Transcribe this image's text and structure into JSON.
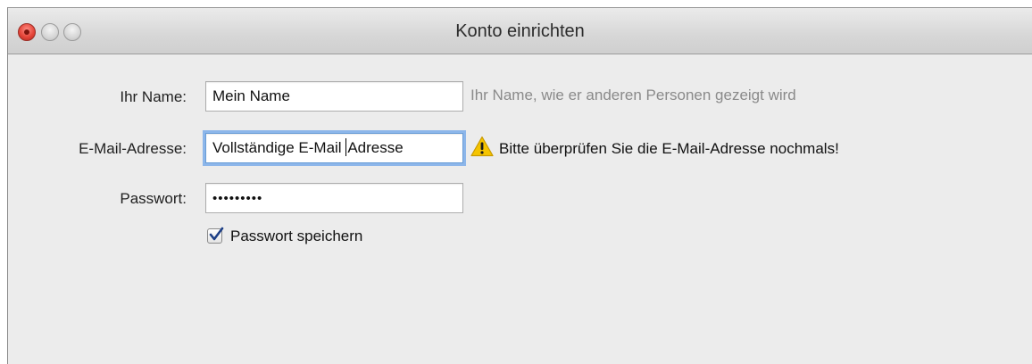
{
  "window": {
    "title": "Konto einrichten"
  },
  "form": {
    "name_label": "Ihr Name:",
    "name_value": "Mein Name",
    "name_hint": "Ihr Name, wie er anderen Personen gezeigt wird",
    "email_label": "E-Mail-Adresse:",
    "email_value_before_caret": "Vollständige E-Mail ",
    "email_value_after_caret": "Adresse",
    "email_warning": "Bitte überprüfen Sie die E-Mail-Adresse nochmals!",
    "password_label": "Passwort:",
    "password_value": "•••••••••",
    "remember_password_label": "Passwort speichern",
    "remember_password_checked": true
  },
  "icons": {
    "warning": "warning-icon",
    "checkbox": "checkmark-icon"
  },
  "colors": {
    "warning_fill": "#f5c400",
    "focus_ring": "#8cb6ea",
    "close_button": "#e5463a"
  }
}
